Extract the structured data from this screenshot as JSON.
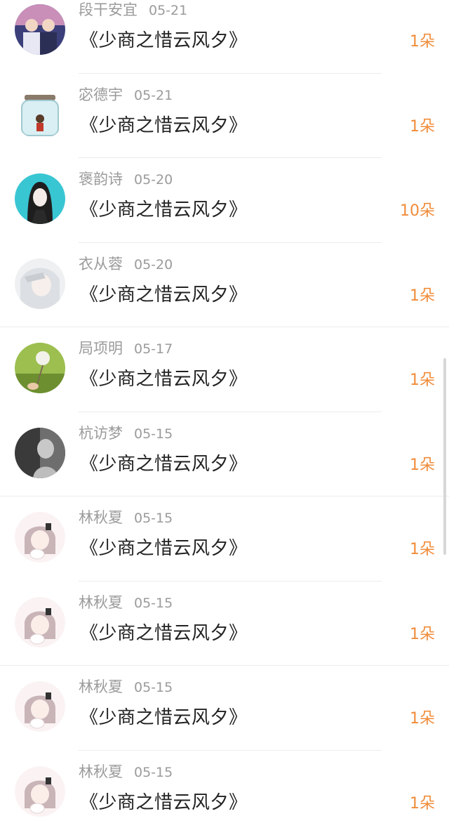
{
  "gift_list": [
    {
      "name": "段干安宜",
      "date": "05-21",
      "title": "《少商之惜云风夕》",
      "amount": "1朵"
    },
    {
      "name": "宓德宇",
      "date": "05-21",
      "title": "《少商之惜云风夕》",
      "amount": "1朵"
    },
    {
      "name": "褒韵诗",
      "date": "05-20",
      "title": "《少商之惜云风夕》",
      "amount": "10朵"
    },
    {
      "name": "衣从蓉",
      "date": "05-20",
      "title": "《少商之惜云风夕》",
      "amount": "1朵"
    },
    {
      "name": "局项明",
      "date": "05-17",
      "title": "《少商之惜云风夕》",
      "amount": "1朵"
    },
    {
      "name": "杭访梦",
      "date": "05-15",
      "title": "《少商之惜云风夕》",
      "amount": "1朵"
    },
    {
      "name": "林秋夏",
      "date": "05-15",
      "title": "《少商之惜云风夕》",
      "amount": "1朵"
    },
    {
      "name": "林秋夏",
      "date": "05-15",
      "title": "《少商之惜云风夕》",
      "amount": "1朵"
    },
    {
      "name": "林秋夏",
      "date": "05-15",
      "title": "《少商之惜云风夕》",
      "amount": "1朵"
    },
    {
      "name": "林秋夏",
      "date": "05-15",
      "title": "《少商之惜云风夕》",
      "amount": "1朵"
    }
  ],
  "colors": {
    "amount": "#f08c3a",
    "meta": "#9b9b9b",
    "title": "#222222"
  }
}
